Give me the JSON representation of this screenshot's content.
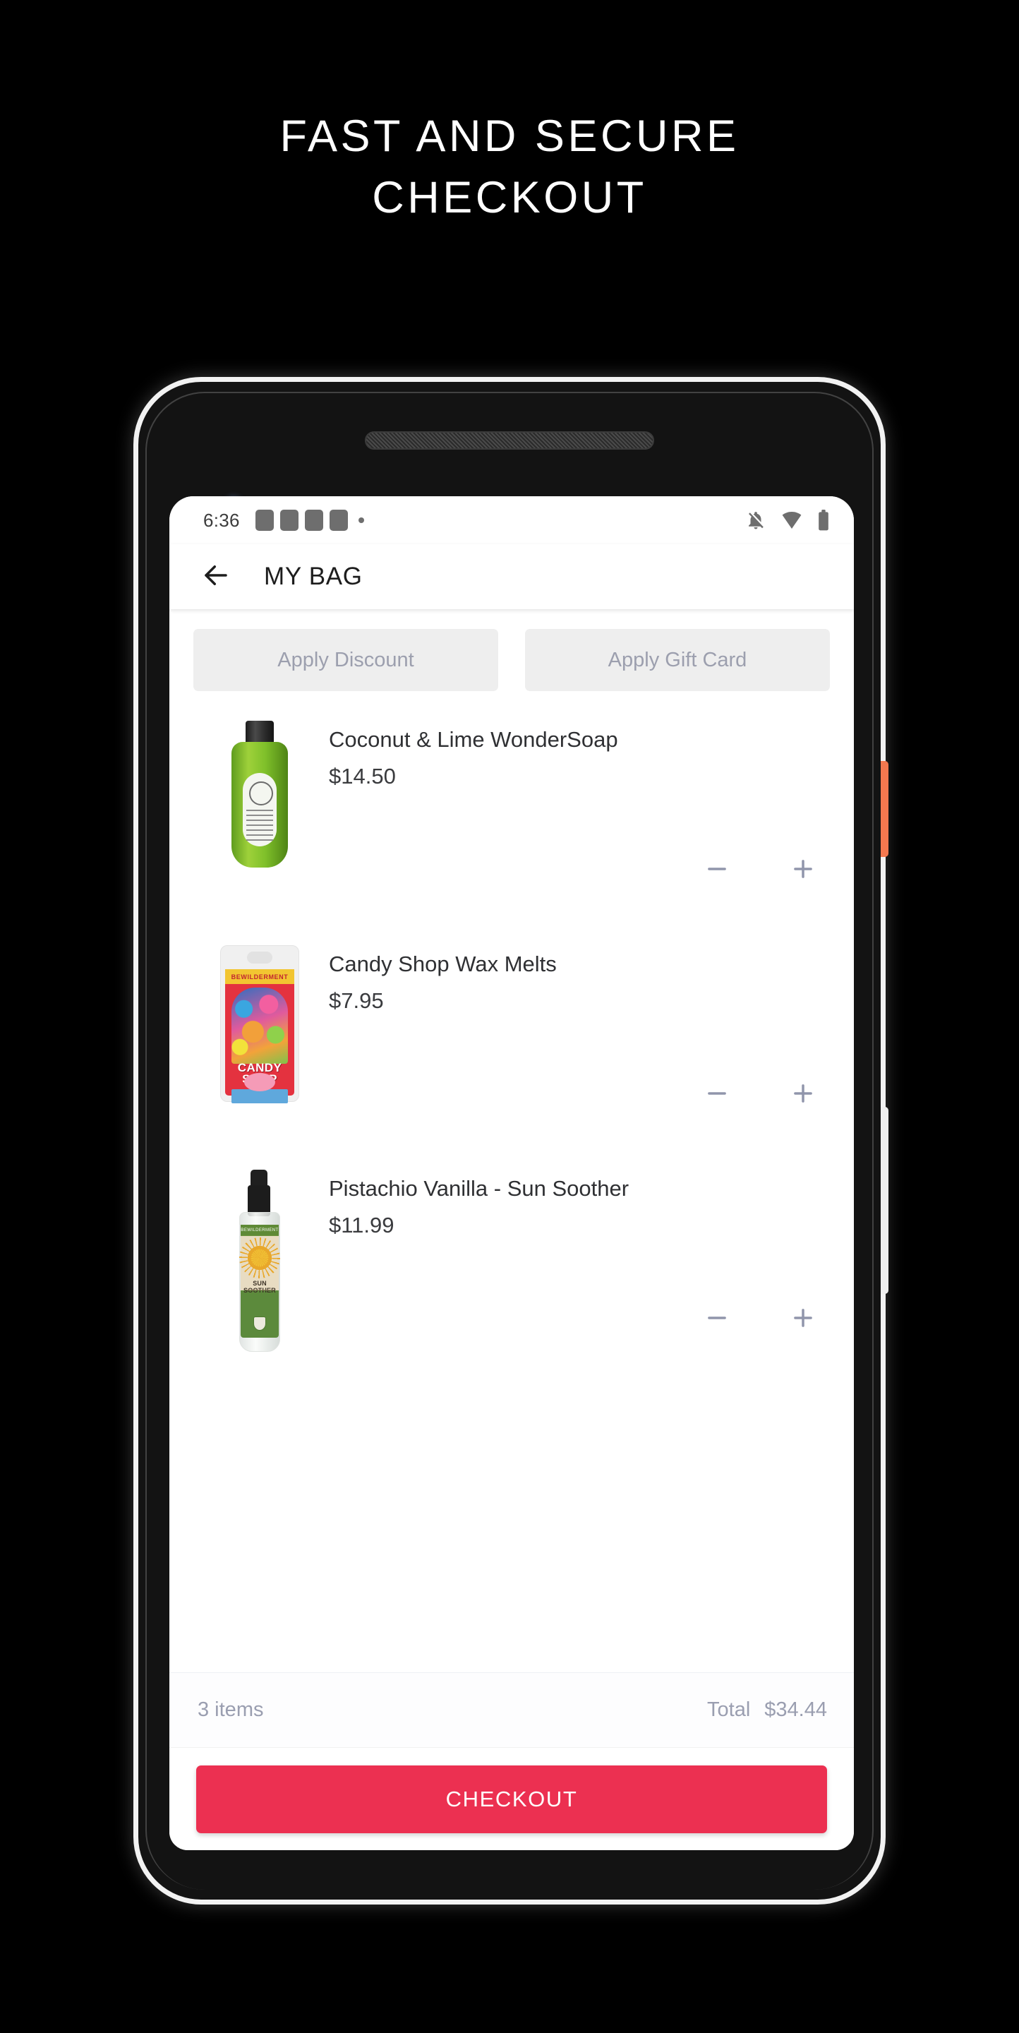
{
  "promo": {
    "headline": "FAST AND SECURE\nCHECKOUT"
  },
  "colors": {
    "accent_checkout": "#ec3051",
    "promo_button_bg": "#eeeeee",
    "promo_button_text": "#9c9fae",
    "totals_text": "#9a9eb0",
    "power_button": "#f4784f",
    "page_background": "#000000",
    "screen_background": "#ffffff"
  },
  "status_bar": {
    "time": "6:36",
    "notification_blocks": 4,
    "icons": [
      "notifications-off-icon",
      "wifi-icon",
      "battery-icon"
    ]
  },
  "app_bar": {
    "back_icon": "back-arrow-icon",
    "title": "MY BAG"
  },
  "promo_actions": [
    {
      "label": "Apply Discount",
      "name": "apply-discount-button"
    },
    {
      "label": "Apply Gift Card",
      "name": "apply-gift-card-button"
    }
  ],
  "cart": {
    "items": [
      {
        "name": "Coconut & Lime WonderSoap",
        "price": "$14.50",
        "thumbnail": "green-soap-bottle-image",
        "decrement_icon": "minus-icon",
        "increment_icon": "plus-icon"
      },
      {
        "name": "Candy Shop Wax Melts",
        "price": "$7.95",
        "thumbnail": "candy-shop-wax-melts-package-image",
        "decrement_icon": "minus-icon",
        "increment_icon": "plus-icon"
      },
      {
        "name": "Pistachio Vanilla - Sun Soother",
        "price": "$11.99",
        "thumbnail": "sun-soother-spray-bottle-image",
        "decrement_icon": "minus-icon",
        "increment_icon": "plus-icon"
      }
    ]
  },
  "totals": {
    "item_count": "3 items",
    "total_label": "Total",
    "total_value": "$34.44"
  },
  "checkout": {
    "label": "CHECKOUT"
  },
  "product_art": {
    "candy": {
      "banner": "BEWILDERMENT",
      "title_line1": "CANDY",
      "title_line2": "SHOP"
    },
    "sun": {
      "brand": "BEWILDERMENT",
      "name": "SUN SOOTHER"
    }
  }
}
